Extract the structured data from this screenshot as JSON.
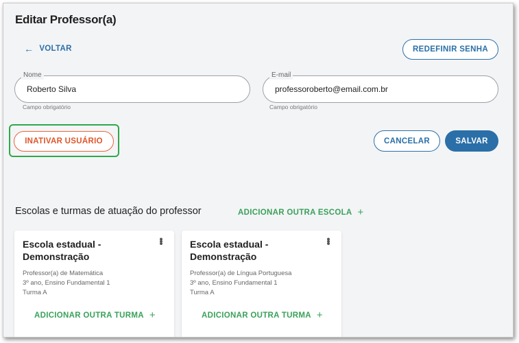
{
  "page": {
    "title": "Editar Professor(a)"
  },
  "header": {
    "back_label": "VOLTAR",
    "back_icon": "arrow-left-icon",
    "reset_password_label": "REDEFINIR SENHA"
  },
  "form": {
    "name": {
      "label": "Nome",
      "value": "Roberto Silva",
      "helper": "Campo obrigatório"
    },
    "email": {
      "label": "E-mail",
      "value": "professoroberto@email.com.br",
      "helper": "Campo obrigatório"
    }
  },
  "actions": {
    "deactivate_label": "INATIVAR USUÁRIO",
    "cancel_label": "CANCELAR",
    "save_label": "SALVAR"
  },
  "schools": {
    "section_title": "Escolas e turmas de atuação do professor",
    "add_school_label": "ADICIONAR OUTRA ESCOLA",
    "plus_glyph": "+",
    "menu_glyph": "⋮",
    "cards": [
      {
        "title": "Escola estadual - Demonstração",
        "role": "Professor(a) de Matemática",
        "grade": "3º ano, Ensino Fundamental 1",
        "class": "Turma A",
        "add_class_label": "ADICIONAR OUTRA TURMA"
      },
      {
        "title": "Escola estadual - Demonstração",
        "role": "Professor(a) de Língua Portuguesa",
        "grade": "3º ano, Ensino Fundamental 1",
        "class": "Turma A",
        "add_class_label": "ADICIONAR OUTRA TURMA"
      }
    ]
  },
  "colors": {
    "primary": "#2a6fa8",
    "danger": "#e0552a",
    "success": "#3aa15a",
    "highlight": "#2fa84a",
    "background": "#f3f4f6"
  }
}
